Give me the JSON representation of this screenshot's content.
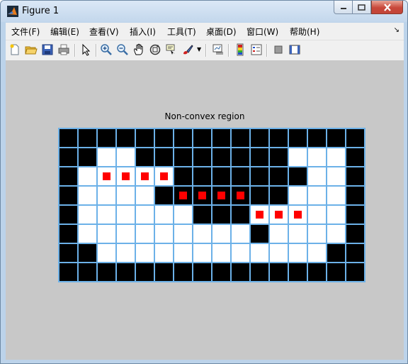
{
  "window": {
    "title": "Figure 1"
  },
  "menu": [
    {
      "label": "文件(F)"
    },
    {
      "label": "编辑(E)"
    },
    {
      "label": "查看(V)"
    },
    {
      "label": "插入(I)"
    },
    {
      "label": "工具(T)"
    },
    {
      "label": "桌面(D)"
    },
    {
      "label": "窗口(W)"
    },
    {
      "label": "帮助(H)"
    }
  ],
  "toolbar": [
    {
      "icon": "new-figure-icon"
    },
    {
      "icon": "open-file-icon"
    },
    {
      "icon": "save-icon"
    },
    {
      "icon": "print-icon"
    },
    {
      "icon": "edit-plot-icon"
    },
    {
      "icon": "zoom-in-icon"
    },
    {
      "icon": "zoom-out-icon"
    },
    {
      "icon": "pan-icon"
    },
    {
      "icon": "rotate-3d-icon"
    },
    {
      "icon": "data-cursor-icon"
    },
    {
      "icon": "brush-icon"
    },
    {
      "icon": "link-plot-icon"
    },
    {
      "icon": "colorbar-icon"
    },
    {
      "icon": "legend-icon"
    },
    {
      "icon": "hide-plot-tools-icon"
    },
    {
      "icon": "show-plot-tools-icon"
    }
  ],
  "plot": {
    "title": "Non-convex region",
    "cell_colors": {
      "on": "#000000",
      "off": "#ffffff",
      "grid": "#6cb1e8",
      "marker": "#ff0000"
    },
    "rows": [
      "1111111111111111",
      "1100111111110001",
      "1000001111111001",
      "1000011111110001",
      "1000000111000001",
      "1000000000100001",
      "1100000000000011",
      "1111111111111111"
    ],
    "markers": [
      {
        "row": 3,
        "col": 3
      },
      {
        "row": 3,
        "col": 4
      },
      {
        "row": 3,
        "col": 5
      },
      {
        "row": 3,
        "col": 6
      },
      {
        "row": 4,
        "col": 7
      },
      {
        "row": 4,
        "col": 8
      },
      {
        "row": 4,
        "col": 9
      },
      {
        "row": 4,
        "col": 10
      },
      {
        "row": 5,
        "col": 11
      },
      {
        "row": 5,
        "col": 12
      },
      {
        "row": 5,
        "col": 13
      }
    ]
  }
}
